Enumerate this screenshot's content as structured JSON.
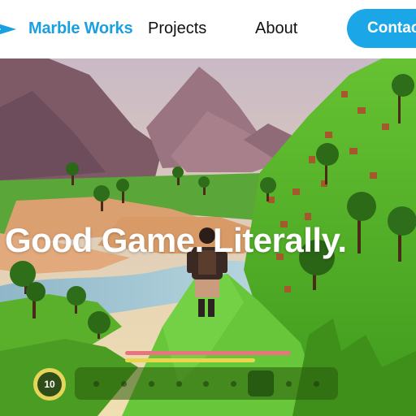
{
  "nav": {
    "brand": "Marble Works",
    "links": [
      "Projects",
      "About"
    ],
    "contact_label": "Contac"
  },
  "hero": {
    "headline": "Good Game. Literally."
  },
  "hud": {
    "level": "10",
    "health_fraction": 0.98,
    "stamina_fraction": 0.77,
    "hotbar_slots": 9,
    "selected_slot": 6
  },
  "colors": {
    "brand": "#1a9fe0",
    "contact_button": "#1ba6e8",
    "health": "#e8747d",
    "stamina": "#e8d64c",
    "grass": "#5bbf2a"
  }
}
